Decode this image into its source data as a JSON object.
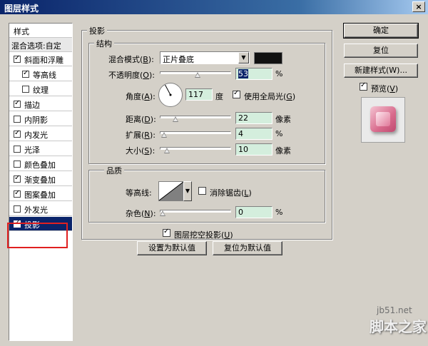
{
  "window": {
    "title": "图层样式",
    "close_label": "×"
  },
  "stylelist": {
    "header": "样式",
    "blend_header": "混合选项:自定",
    "items": [
      {
        "label": "斜面和浮雕",
        "checked": true
      },
      {
        "label": "等高线",
        "checked": true
      },
      {
        "label": "纹理",
        "checked": false
      },
      {
        "label": "描边",
        "checked": true
      },
      {
        "label": "内阴影",
        "checked": false
      },
      {
        "label": "内发光",
        "checked": true
      },
      {
        "label": "光泽",
        "checked": false
      },
      {
        "label": "颜色叠加",
        "checked": false
      },
      {
        "label": "渐变叠加",
        "checked": true
      },
      {
        "label": "图案叠加",
        "checked": true
      },
      {
        "label": "外发光",
        "checked": false
      },
      {
        "label": "投影",
        "checked": true,
        "selected": true
      }
    ]
  },
  "drop_shadow": {
    "section_title": "投影",
    "structure_title": "结构",
    "blend_mode_label": "混合模式(",
    "blend_mode_key": "B",
    "blend_mode_value": "正片叠底",
    "shadow_color": "#111111",
    "opacity_label": "不透明度(",
    "opacity_key": "O",
    "opacity_value": "53",
    "opacity_unit": "%",
    "angle_label": "角度(",
    "angle_key": "A",
    "angle_value": "117",
    "angle_unit": "度",
    "global_light_label": "使用全局光(",
    "global_light_key": "G",
    "global_light_checked": true,
    "distance_label": "距离(",
    "distance_key": "D",
    "distance_value": "22",
    "distance_unit": "像素",
    "spread_label": "扩展(",
    "spread_key": "R",
    "spread_value": "4",
    "spread_unit": "%",
    "size_label": "大小(",
    "size_key": "S",
    "size_value": "10",
    "size_unit": "像素",
    "quality_title": "品质",
    "contour_label": "等高线:",
    "antialias_label": "消除锯齿(",
    "antialias_key": "L",
    "antialias_checked": false,
    "noise_label": "杂色(",
    "noise_key": "N",
    "noise_value": "0",
    "noise_unit": "%",
    "knockout_label": "图层挖空投影(",
    "knockout_key": "U",
    "knockout_checked": true,
    "make_default_label": "设置为默认值",
    "reset_default_label": "复位为默认值"
  },
  "buttons": {
    "ok": "确定",
    "reset": "复位",
    "new_style": "新建样式(W)...",
    "preview_label": "预览(",
    "preview_key": "V",
    "preview_checked": true
  },
  "watermark": {
    "site": "jb51.net",
    "brand": "脚本之家"
  }
}
